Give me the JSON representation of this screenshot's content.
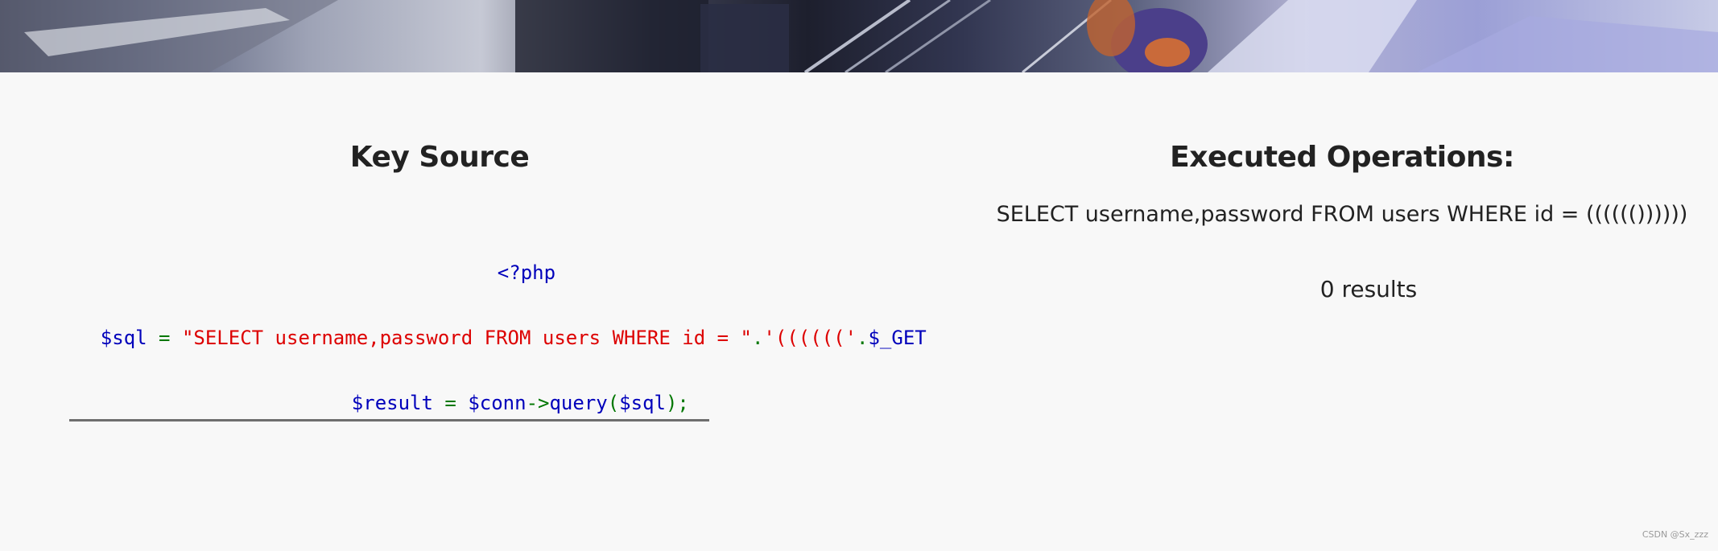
{
  "key_source": {
    "heading": "Key Source",
    "php_open": "<?php",
    "sql_var": "$sql",
    "sql_eq": " = ",
    "sql_string": "\"SELECT username,password FROM users WHERE id = \"",
    "sql_concat1": ".",
    "sql_parens": "'(((((('",
    "sql_concat2": ".",
    "sql_get": "$_GET",
    "result_var": "$result",
    "result_eq": " = ",
    "conn_var": "$conn",
    "arrow": "->",
    "query_fn": "query",
    "paren_open": "(",
    "query_arg": "$sql",
    "paren_close": ");"
  },
  "executed": {
    "heading": "Executed Operations:",
    "query_text": "SELECT username,password FROM users WHERE id = (((((())))))",
    "results_text": "0 results"
  },
  "watermark": "CSDN @Sx_zzz",
  "colors": {
    "php_variable": "#0000bb",
    "php_operator": "#007700",
    "php_string": "#dd0000",
    "background": "#f8f8f8"
  }
}
